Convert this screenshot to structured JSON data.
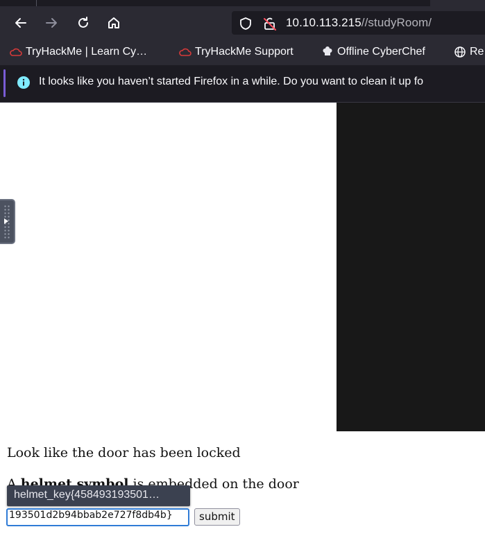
{
  "browser": {
    "url_host": "10.10.113.215",
    "url_path": "//studyRoom/",
    "bookmarks": [
      {
        "label": "TryHackMe | Learn Cy…",
        "icon": "thm-cloud-icon"
      },
      {
        "label": "TryHackMe Support",
        "icon": "thm-cloud-icon"
      },
      {
        "label": "Offline CyberChef",
        "icon": "chef-hat-icon"
      },
      {
        "label": "Re",
        "icon": "globe-icon"
      }
    ],
    "notification": "It looks like you haven’t started Firefox in a while. Do you want to clean it up fo"
  },
  "page": {
    "line1": "Look like the door has been locked",
    "line2_prefix": "A ",
    "line2_bold": "helmet symbol",
    "line2_suffix": " is embedded on the door",
    "autocomplete_suggestion": "helmet_key{458493193501…",
    "key_input_value": "193501d2b94bbab2e727f8db4b}",
    "submit_label": "submit"
  },
  "colors": {
    "chrome_bg": "#2b2a33",
    "urlbar_bg": "#1c1b22",
    "focus_ring": "#2f7bd6",
    "notification_accent": "#7a5cd6"
  }
}
